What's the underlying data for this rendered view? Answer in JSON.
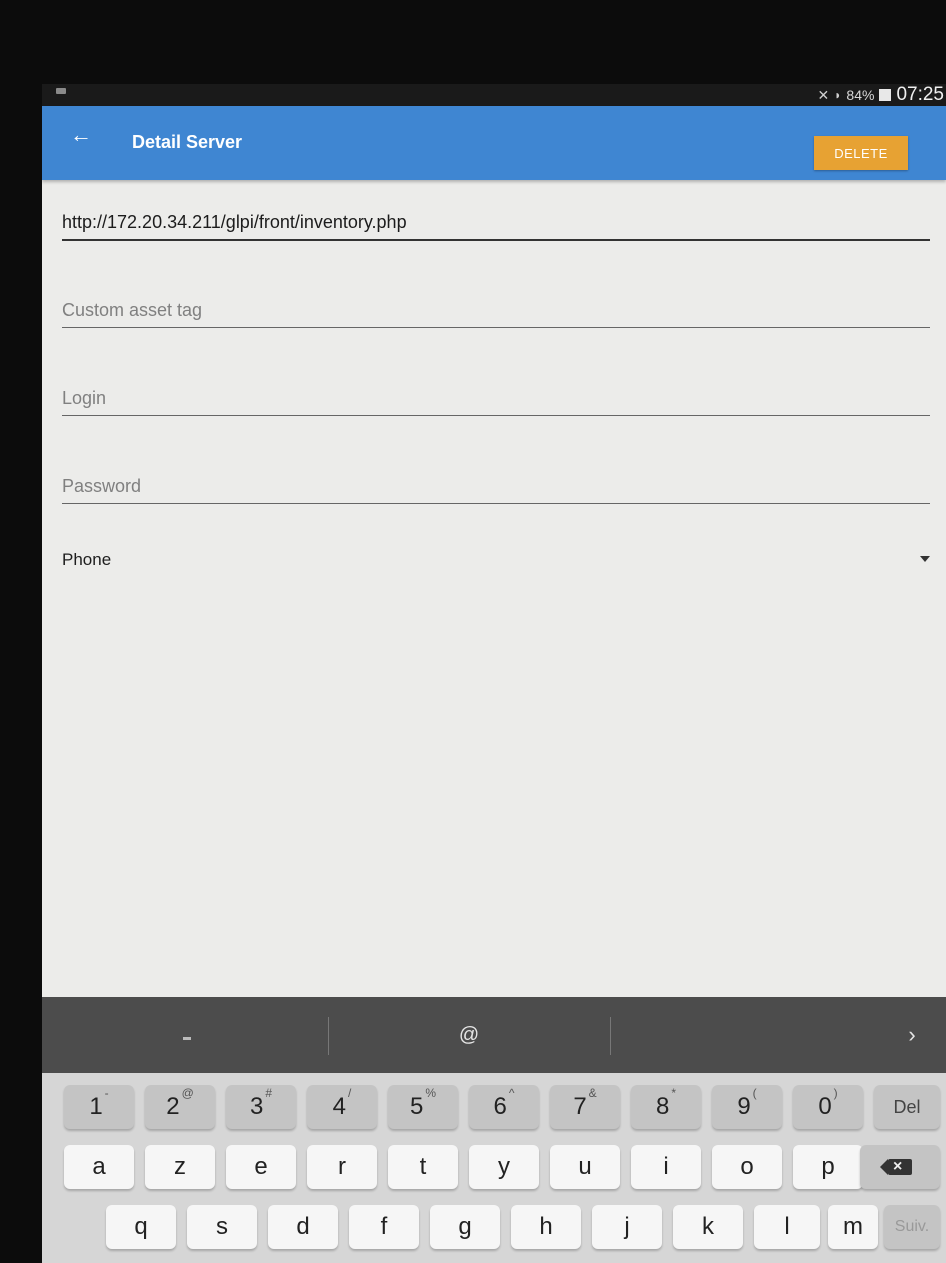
{
  "status_bar": {
    "battery": "84%",
    "time": "07:25",
    "icons": [
      "mute-icon",
      "wifi-icon",
      "battery-icon"
    ]
  },
  "toolbar": {
    "back_icon": "arrow-left-icon",
    "title": "Detail Server",
    "delete_label": "DELETE",
    "color": "#3f86d2",
    "delete_color": "#e7a233"
  },
  "form": {
    "url_value": "http://172.20.34.211/glpi/front/inventory.php",
    "tag_placeholder": "Custom asset tag",
    "login_placeholder": "Login",
    "password_placeholder": "Password",
    "device_type": "Phone"
  },
  "keyboard": {
    "suggestions": [
      "-",
      "@",
      "'"
    ],
    "row1": [
      {
        "key": "1",
        "alt": "-"
      },
      {
        "key": "2",
        "alt": "@"
      },
      {
        "key": "3",
        "alt": "#"
      },
      {
        "key": "4",
        "alt": "/"
      },
      {
        "key": "5",
        "alt": "%"
      },
      {
        "key": "6",
        "alt": "^"
      },
      {
        "key": "7",
        "alt": "&"
      },
      {
        "key": "8",
        "alt": "*"
      },
      {
        "key": "9",
        "alt": "("
      },
      {
        "key": "0",
        "alt": ")"
      }
    ],
    "del_label": "Del",
    "row2": [
      "a",
      "z",
      "e",
      "r",
      "t",
      "y",
      "u",
      "i",
      "o",
      "p"
    ],
    "row3": [
      "q",
      "s",
      "d",
      "f",
      "g",
      "h",
      "j",
      "k",
      "l",
      "m"
    ],
    "next_label": "Suiv."
  }
}
